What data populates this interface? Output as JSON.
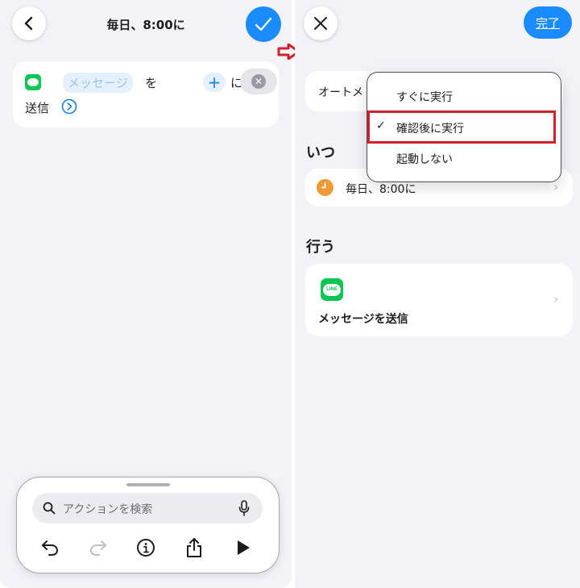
{
  "left": {
    "header": {
      "title": "毎日、8:00に"
    },
    "action": {
      "token_message": "メッセージ",
      "text_wo": "を",
      "text_ni": "に",
      "text_send": "送信"
    },
    "toolbar": {
      "search_placeholder": "アクションを検索"
    }
  },
  "right": {
    "header": {
      "done_label": "完了"
    },
    "auto_row_label": "オートメ",
    "menu": {
      "items": [
        {
          "label": "すぐに実行",
          "checked": false
        },
        {
          "label": "確認後に実行",
          "checked": true
        },
        {
          "label": "起動しない",
          "checked": false
        }
      ],
      "check_glyph": "✓"
    },
    "when": {
      "title": "いつ",
      "schedule": "毎日、8:00に"
    },
    "do": {
      "title": "行う",
      "action_label": "メッセージを送信",
      "app_icon_text": "LINE"
    }
  },
  "colors": {
    "accent": "#1a8cff",
    "line_green": "#06c755",
    "highlight_red": "#d31f2a",
    "arrow_red": "#d31f2a",
    "clock_orange": "#f09a37"
  },
  "icons": [
    "back-chevron-icon",
    "checkmark-icon",
    "line-app-icon",
    "plus-icon",
    "clear-icon",
    "chevron-right-circle-icon",
    "search-icon",
    "microphone-icon",
    "undo-icon",
    "redo-icon",
    "info-icon",
    "share-icon",
    "play-icon",
    "close-icon",
    "clock-icon",
    "chevron-right-icon",
    "arrow-right-icon"
  ]
}
